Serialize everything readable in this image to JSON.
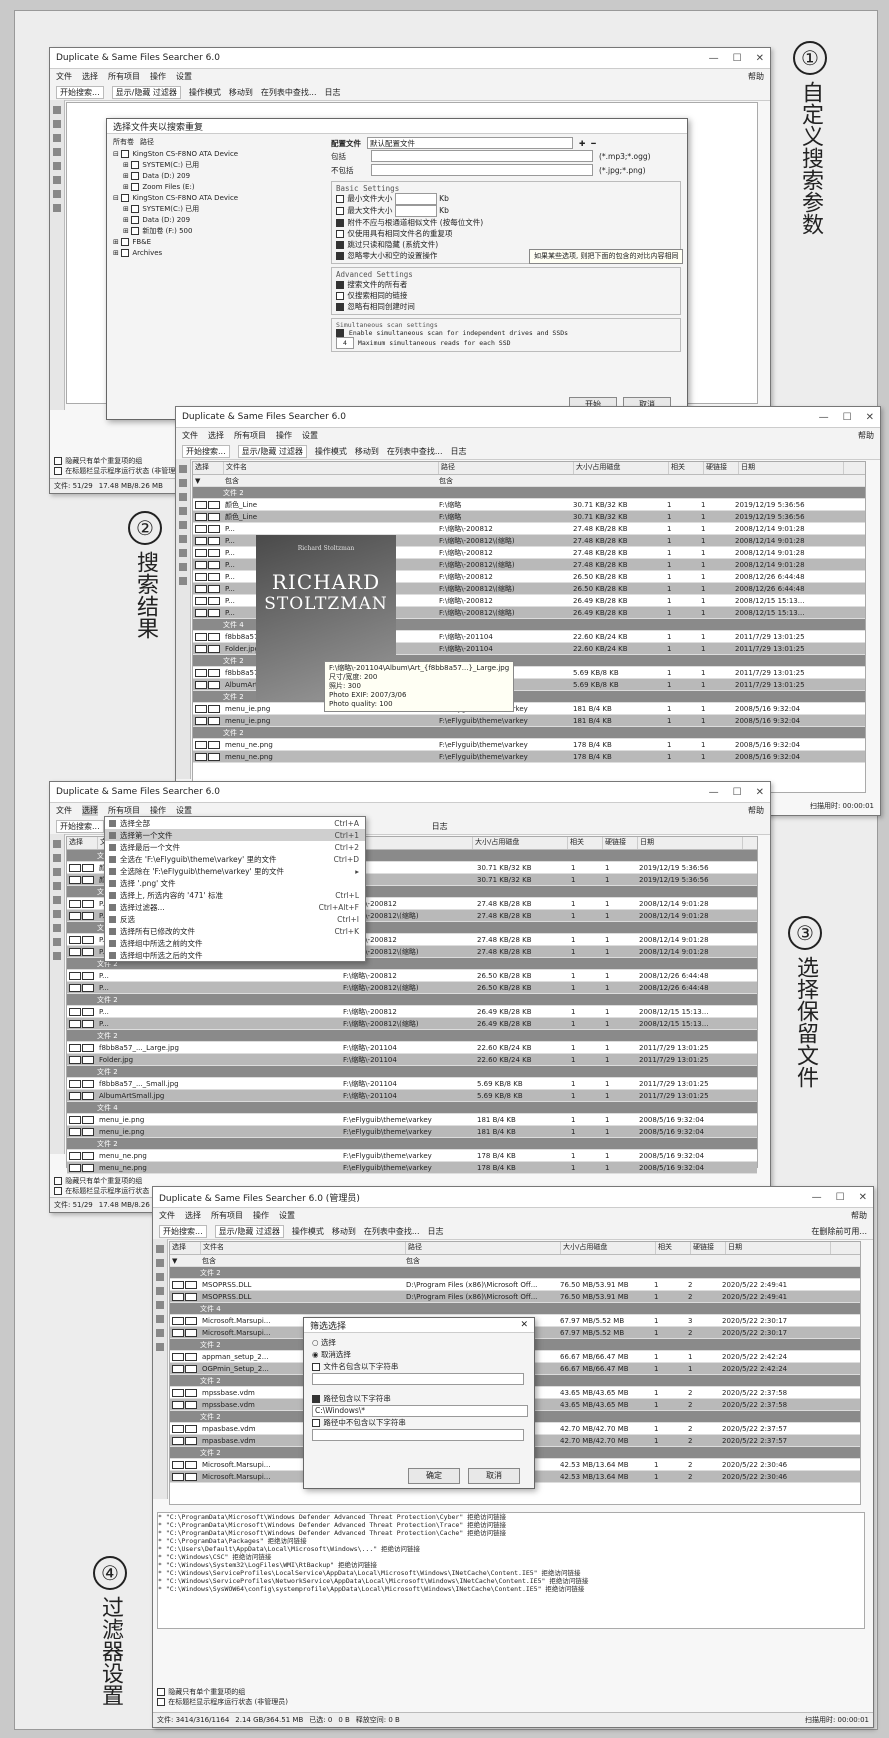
{
  "labels": [
    {
      "num": "①",
      "text": "自定义搜索参数"
    },
    {
      "num": "②",
      "text": "搜索结果"
    },
    {
      "num": "③",
      "text": "选择保留文件"
    },
    {
      "num": "④",
      "text": "过滤器设置"
    }
  ],
  "app": {
    "title": "Duplicate & Same Files Searcher 6.0",
    "title4": "Duplicate & Same Files Searcher 6.0 (管理员)",
    "menu": [
      "文件",
      "选择",
      "所有项目",
      "操作",
      "设置"
    ],
    "help": "帮助",
    "toolbar": [
      "开始搜索...",
      "显示/隐藏 过滤器",
      "操作模式",
      "移动到",
      "在列表中查找...",
      "日志"
    ],
    "columns": [
      "选择",
      "文件名",
      "路径",
      "大小/占用磁盘",
      "相关",
      "硬链接",
      "日期"
    ],
    "filter_label": "包含",
    "check_option1": "隐藏只有单个重复项的组",
    "check_option2": "在标题栏显示程序运行状态 (非管理员)",
    "status1": [
      "文件: 51/29",
      "17.48 MB/8.26 MB"
    ],
    "status4": [
      "文件: 3414/316/1164",
      "2.14 GB/364.51 MB",
      "已选: 0",
      "0 B",
      "释放空间: 0 B"
    ],
    "elapsed": "扫描用时: 00:00:01"
  },
  "win1": {
    "dialog_title": "选择文件夹以搜索重复",
    "tabs": [
      "所有卷",
      "路径"
    ],
    "tree": [
      "KingSton CS-F8NO ATA Device",
      "SYSTEM(C:) 已用",
      "Data (D:) 209",
      "Zoom Files (E:)",
      "KingSton CS-F8NO ATA Device",
      "SYSTEM(C:) 已用",
      "Data (D:) 209",
      "新加卷 (F:) 500",
      "FB&E",
      "Archives"
    ],
    "profile_label": "配置文件",
    "profile_value": "默认配置文件",
    "include_label": "包括",
    "include_hint": "(*.mp3;*.ogg)",
    "exclude_label": "不包括",
    "exclude_hint": "(*.jpg;*.png)",
    "basic_title": "Basic Settings",
    "basic": [
      "最小文件大小",
      "最大文件大小",
      "附件不应与根通道相似文件 (按每位文件)",
      "仅使用具有相同文件名的重复项",
      "跳过只读和隐藏 (系统文件)",
      "忽略零大小和空的设置操作"
    ],
    "size_unit": "Kb",
    "advanced_title": "Advanced Settings",
    "advanced": [
      "搜索文件的所有者",
      "仅搜索相同的链接",
      "忽略有相同创建时间"
    ],
    "simul_title": "Simultaneous scan settings",
    "simul": [
      "Enable simultaneous scan for independent drives and SSDs",
      "Maximum simultaneous reads for each SSD"
    ],
    "simul_num": "4",
    "tip": "如果某些选项, 则把下面的包含的对比内容相同",
    "btn_ok": "开始",
    "btn_cancel": "取消"
  },
  "win2": {
    "groups": [
      "文件 2",
      "文件 4",
      "文件 2",
      "文件 2",
      "文件 2",
      "文件 2"
    ],
    "rows": [
      {
        "name": "颜色_Line",
        "path": "F:\\缩略",
        "size": "30.71 KB/32 KB",
        "rel": "1",
        "hl": "1",
        "date": "2019/12/19 5:36:56"
      },
      {
        "name": "颜色_Line",
        "path": "F:\\缩略",
        "size": "30.71 KB/32 KB",
        "rel": "1",
        "hl": "1",
        "date": "2019/12/19 5:36:56"
      },
      {
        "name": "P...",
        "path": "F:\\缩略\\-200812",
        "size": "27.48 KB/28 KB",
        "rel": "1",
        "hl": "1",
        "date": "2008/12/14 9:01:28"
      },
      {
        "name": "P...",
        "path": "F:\\缩略\\-200812\\(缩略)",
        "size": "27.48 KB/28 KB",
        "rel": "1",
        "hl": "1",
        "date": "2008/12/14 9:01:28"
      },
      {
        "name": "P...",
        "path": "F:\\缩略\\-200812",
        "size": "27.48 KB/28 KB",
        "rel": "1",
        "hl": "1",
        "date": "2008/12/14 9:01:28"
      },
      {
        "name": "P...",
        "path": "F:\\缩略\\-200812\\(缩略)",
        "size": "27.48 KB/28 KB",
        "rel": "1",
        "hl": "1",
        "date": "2008/12/14 9:01:28"
      },
      {
        "name": "P...",
        "path": "F:\\缩略\\-200812",
        "size": "26.50 KB/28 KB",
        "rel": "1",
        "hl": "1",
        "date": "2008/12/26 6:44:48"
      },
      {
        "name": "P...",
        "path": "F:\\缩略\\-200812\\(缩略)",
        "size": "26.50 KB/28 KB",
        "rel": "1",
        "hl": "1",
        "date": "2008/12/26 6:44:48"
      },
      {
        "name": "P...",
        "path": "F:\\缩略\\-200812",
        "size": "26.49 KB/28 KB",
        "rel": "1",
        "hl": "1",
        "date": "2008/12/15 15:13..."
      },
      {
        "name": "P...",
        "path": "F:\\缩略\\-200812\\(缩略)",
        "size": "26.49 KB/28 KB",
        "rel": "1",
        "hl": "1",
        "date": "2008/12/15 15:13..."
      },
      {
        "name": "f8bb8a57_..._Large.jpg",
        "path": "F:\\缩略\\-201104",
        "size": "22.60 KB/24 KB",
        "rel": "1",
        "hl": "1",
        "date": "2011/7/29 13:01:25"
      },
      {
        "name": "Folder.jpg",
        "path": "F:\\缩略\\-201104",
        "size": "22.60 KB/24 KB",
        "rel": "1",
        "hl": "1",
        "date": "2011/7/29 13:01:25"
      },
      {
        "name": "f8bb8a57_..._Small.jpg",
        "path": "F:\\缩略\\-201104",
        "size": "5.69 KB/8 KB",
        "rel": "1",
        "hl": "1",
        "date": "2011/7/29 13:01:25"
      },
      {
        "name": "AlbumArtSmall.jpg",
        "path": "F:\\缩略\\-201104",
        "size": "5.69 KB/8 KB",
        "rel": "1",
        "hl": "1",
        "date": "2011/7/29 13:01:25"
      },
      {
        "name": "menu_ie.png",
        "path": "F:\\eFlyguib\\theme\\varkey",
        "size": "181 B/4 KB",
        "rel": "1",
        "hl": "1",
        "date": "2008/5/16 9:32:04"
      },
      {
        "name": "menu_ie.png",
        "path": "F:\\eFlyguib\\theme\\varkey",
        "size": "181 B/4 KB",
        "rel": "1",
        "hl": "1",
        "date": "2008/5/16 9:32:04"
      },
      {
        "name": "menu_ne.png",
        "path": "F:\\eFlyguib\\theme\\varkey",
        "size": "178 B/4 KB",
        "rel": "1",
        "hl": "1",
        "date": "2008/5/16 9:32:04"
      },
      {
        "name": "menu_ne.png",
        "path": "F:\\eFlyguib\\theme\\varkey",
        "size": "178 B/4 KB",
        "rel": "1",
        "hl": "1",
        "date": "2008/5/16 9:32:04"
      }
    ],
    "cover_top": "Richard Stoltzman",
    "cover_line1": "RICHARD",
    "cover_line2": "STOLTZMAN",
    "tooltip": [
      "F:\\缩略\\-201104\\Album\\Art_{f8bb8a57...}_Large.jpg",
      "尺寸/宽度: 200",
      "照片: 300",
      "Photo EXIF: 2007/3/06",
      "Photo quality: 100"
    ]
  },
  "win3": {
    "menu_items": [
      {
        "label": "选择全部",
        "sc": "Ctrl+A"
      },
      {
        "label": "选择第一个文件",
        "sc": "Ctrl+1"
      },
      {
        "label": "选择最后一个文件",
        "sc": "Ctrl+2"
      },
      {
        "label": "全选在 'F:\\eFlyguib\\theme\\varkey' 里的文件",
        "sc": "Ctrl+D"
      },
      {
        "label": "全选除在 'F:\\eFlyguib\\theme\\varkey' 里的文件",
        "sc": "▸"
      },
      {
        "label": "选择 '.png' 文件",
        "sc": ""
      },
      {
        "label": "选择上, 所选内容的 '471' 标准",
        "sc": "Ctrl+L"
      },
      {
        "label": "选择过滤器...",
        "sc": "Ctrl+Alt+F"
      },
      {
        "label": "反选",
        "sc": "Ctrl+I"
      },
      {
        "label": "选择所有已修改的文件",
        "sc": "Ctrl+K"
      },
      {
        "label": "选择组中所选之前的文件",
        "sc": ""
      },
      {
        "label": "选择组中所选之后的文件",
        "sc": ""
      }
    ]
  },
  "win4": {
    "filter_title": "筛选选择",
    "radio1": "选择",
    "radio2": "取消选择",
    "chk1": "文件名包含以下字符串",
    "chk2": "路径包含以下字符串",
    "path_value": "C:\\Windows\\*",
    "chk3": "路径中不包含以下字符串",
    "btn_ok": "确定",
    "btn_cancel": "取消",
    "rows": [
      {
        "name": "MSOPRSS.DLL",
        "path": "D:\\Program Files (x86)\\Microsoft Off...",
        "size": "76.50 MB/53.91 MB",
        "rel": "1",
        "hl": "2",
        "date": "2020/5/22 2:49:41"
      },
      {
        "name": "MSOPRSS.DLL",
        "path": "D:\\Program Files (x86)\\Microsoft Off...",
        "size": "76.50 MB/53.91 MB",
        "rel": "1",
        "hl": "2",
        "date": "2020/5/22 2:49:41"
      },
      {
        "name": "Microsoft.Marsupi...",
        "path": "...Windows\\...",
        "size": "67.97 MB/5.52 MB",
        "rel": "1",
        "hl": "3",
        "date": "2020/5/22 2:30:17"
      },
      {
        "name": "Microsoft.Marsupi...",
        "path": "...Windows\\...",
        "size": "67.97 MB/5.52 MB",
        "rel": "1",
        "hl": "2",
        "date": "2020/5/22 2:30:17"
      },
      {
        "name": "appman_setup_2...",
        "path": "...OGPmin",
        "size": "66.67 MB/66.47 MB",
        "rel": "1",
        "hl": "1",
        "date": "2020/5/22 2:42:24"
      },
      {
        "name": "OGPmin_Setup_2...",
        "path": "...OGPmin",
        "size": "66.67 MB/66.47 MB",
        "rel": "1",
        "hl": "1",
        "date": "2020/5/22 2:42:24"
      },
      {
        "name": "mpssbase.vdm",
        "path": "...Windows\\...",
        "size": "43.65 MB/43.65 MB",
        "rel": "1",
        "hl": "2",
        "date": "2020/5/22 2:37:58"
      },
      {
        "name": "mpssbase.vdm",
        "path": "...Windows\\...",
        "size": "43.65 MB/43.65 MB",
        "rel": "1",
        "hl": "2",
        "date": "2020/5/22 2:37:58"
      },
      {
        "name": "mpasbase.vdm",
        "path": "...Windows\\...",
        "size": "42.70 MB/42.70 MB",
        "rel": "1",
        "hl": "2",
        "date": "2020/5/22 2:37:57"
      },
      {
        "name": "mpasbase.vdm",
        "path": "...Windows\\...",
        "size": "42.70 MB/42.70 MB",
        "rel": "1",
        "hl": "2",
        "date": "2020/5/22 2:37:57"
      },
      {
        "name": "Microsoft.Marsupi...",
        "path": "...Microsoft Off...",
        "size": "42.53 MB/13.64 MB",
        "rel": "1",
        "hl": "2",
        "date": "2020/5/22 2:30:46"
      },
      {
        "name": "Microsoft.Marsupi...",
        "path": "...Microsoft Off...",
        "size": "42.53 MB/13.64 MB",
        "rel": "1",
        "hl": "2",
        "date": "2020/5/22 2:30:46"
      }
    ],
    "log": [
      "* \"C:\\ProgramData\\Microsoft\\Windows Defender Advanced Threat Protection\\Cyber\" 拒绝访问链接",
      "* \"C:\\ProgramData\\Microsoft\\Windows Defender Advanced Threat Protection\\Trace\" 拒绝访问链接",
      "* \"C:\\ProgramData\\Microsoft\\Windows Defender Advanced Threat Protection\\Cache\" 拒绝访问链接",
      "* \"C:\\ProgramData\\Packages\" 拒绝访问链接",
      "* \"C:\\Users\\Default\\AppData\\Local\\Microsoft\\Windows\\...\" 拒绝访问链接",
      "* \"C:\\Windows\\CSC\" 拒绝访问链接",
      "* \"C:\\Windows\\System32\\LogFiles\\WMI\\RtBackup\" 拒绝访问链接",
      "* \"C:\\Windows\\ServiceProfiles\\LocalService\\AppData\\Local\\Microsoft\\Windows\\INetCache\\Content.IE5\" 拒绝访问链接",
      "* \"C:\\Windows\\ServiceProfiles\\NetworkService\\AppData\\Local\\Microsoft\\Windows\\INetCache\\Content.IE5\" 拒绝访问链接",
      "* \"C:\\Windows\\SysWOW64\\config\\systemprofile\\AppData\\Local\\Microsoft\\Windows\\INetCache\\Content.IE5\" 拒绝访问链接"
    ],
    "toolbar_right": "在删除前可用..."
  }
}
